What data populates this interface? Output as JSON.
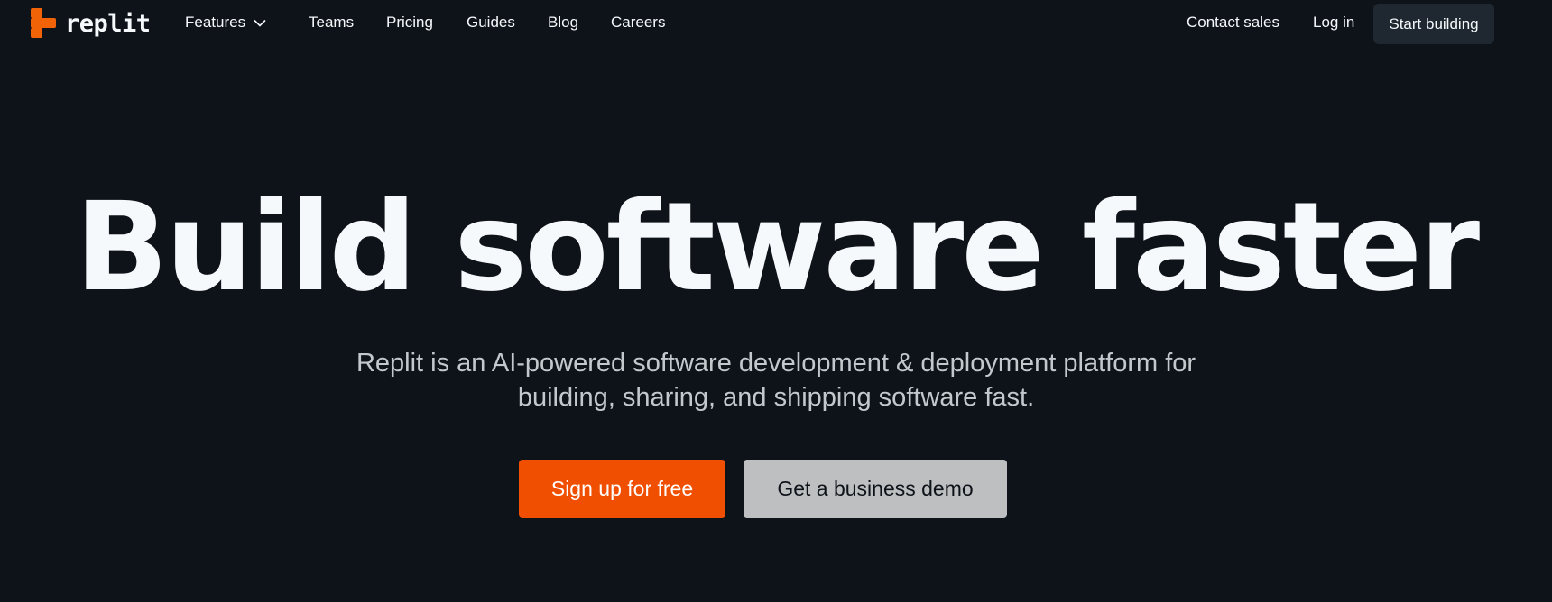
{
  "brand": {
    "name": "replit",
    "accent": "#f26207"
  },
  "nav": {
    "features": "Features",
    "teams": "Teams",
    "pricing": "Pricing",
    "guides": "Guides",
    "blog": "Blog",
    "careers": "Careers",
    "contact_sales": "Contact sales",
    "log_in": "Log in",
    "start_building": "Start building"
  },
  "hero": {
    "title": "Build software faster",
    "subtitle_line1": "Replit is an AI-powered software development & deployment platform for",
    "subtitle_line2": "building, sharing, and shipping software fast.",
    "primary_cta": "Sign up for free",
    "secondary_cta": "Get a business demo",
    "primary_color": "#f04e00"
  }
}
